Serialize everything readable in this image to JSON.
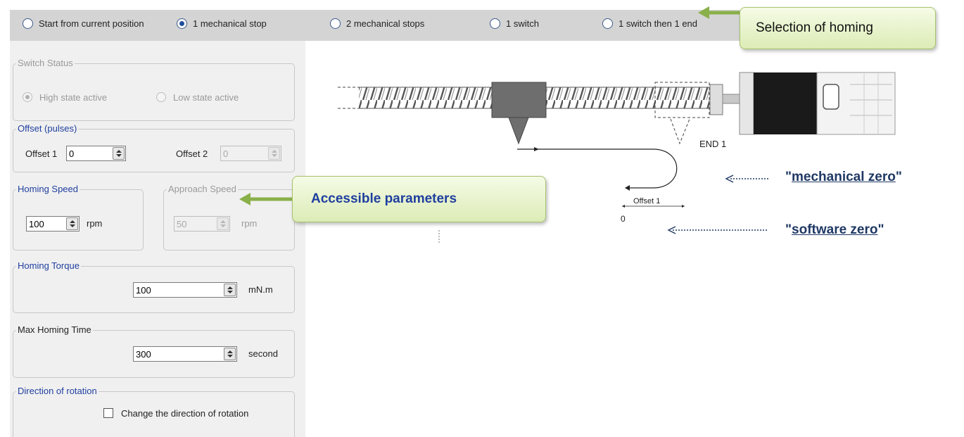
{
  "homing_modes": [
    {
      "label": "Start from current position",
      "selected": false
    },
    {
      "label": "1 mechanical stop",
      "selected": true
    },
    {
      "label": "2 mechanical stops",
      "selected": false
    },
    {
      "label": "1 switch",
      "selected": false
    },
    {
      "label": "1 switch then 1 end",
      "selected": false
    }
  ],
  "switch_status": {
    "title": "Switch Status",
    "high_label": "High state active",
    "low_label": "Low state active",
    "high_selected": true
  },
  "offset": {
    "title": "Offset (pulses)",
    "offset1_label": "Offset 1",
    "offset1_value": "0",
    "offset2_label": "Offset 2",
    "offset2_value": "0"
  },
  "homing_speed": {
    "title": "Homing Speed",
    "value": "100",
    "unit": "rpm"
  },
  "approach_speed": {
    "title": "Approach Speed",
    "value": "50",
    "unit": "rpm"
  },
  "homing_torque": {
    "title": "Homing Torque",
    "value": "100",
    "unit": "mN.m"
  },
  "max_homing_time": {
    "title": "Max Homing Time",
    "value": "300",
    "unit": "second"
  },
  "direction": {
    "title": "Direction of rotation",
    "checkbox_label": "Change the direction of rotation",
    "checked": false
  },
  "diagram": {
    "end_label": "END 1",
    "offset_label": "Offset 1",
    "zero_label": "0"
  },
  "callouts": {
    "selection": "Selection of homing",
    "accessible": "Accessible parameters"
  },
  "annotations": {
    "mechanical_zero": "mechanical zero",
    "software_zero": "software zero",
    "quote": "\""
  },
  "colors": {
    "accent_blue": "#1f3f9f",
    "annotation_navy": "#1f3864",
    "callout_green": "#dcecb6",
    "arrow_green": "#8ab04a"
  }
}
